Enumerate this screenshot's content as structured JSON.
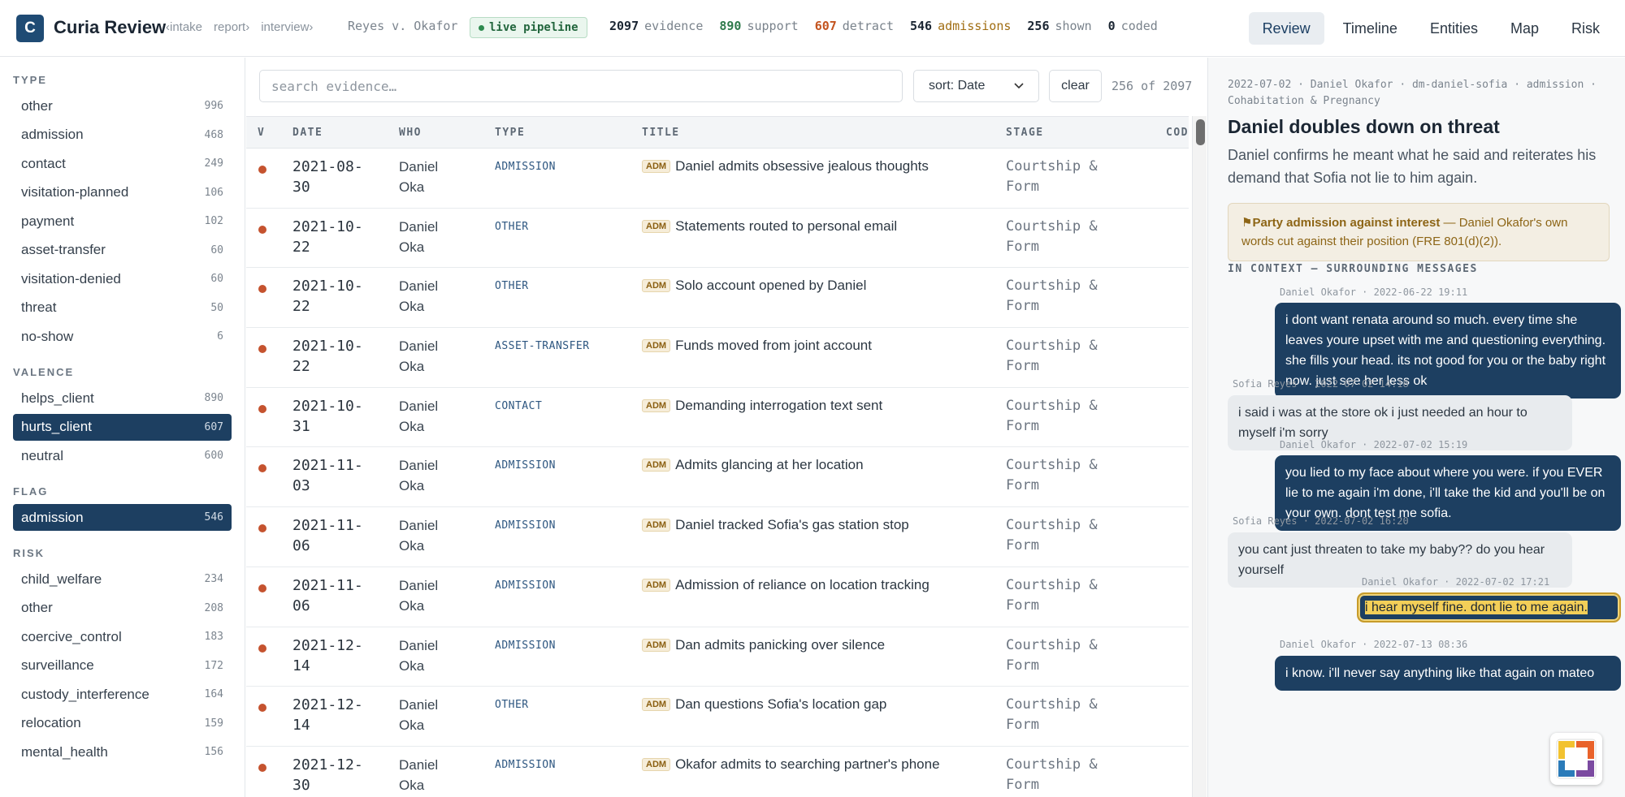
{
  "header": {
    "logo_letter": "C",
    "app_title": "Curia Review",
    "breadcrumbs": [
      "‹intake",
      "report›",
      "interview›"
    ],
    "case_name": "Reyes v. Okafor",
    "pipeline_label": "live pipeline",
    "stats": [
      {
        "value": "2097",
        "label": "evidence",
        "color": "#1b2633"
      },
      {
        "value": "890",
        "label": "support",
        "color": "#2f7a4b"
      },
      {
        "value": "607",
        "label": "detract",
        "color": "#c4541f"
      },
      {
        "value": "546",
        "label": "admissions",
        "color": "#a06d12"
      },
      {
        "value": "256",
        "label": "shown",
        "color": "#1b2633"
      },
      {
        "value": "0",
        "label": "coded",
        "color": "#1b2633"
      }
    ],
    "nav": [
      "Review",
      "Timeline",
      "Entities",
      "Map",
      "Risk"
    ]
  },
  "sidebar": {
    "type_title": "TYPE",
    "types": [
      {
        "label": "other",
        "count": "996"
      },
      {
        "label": "admission",
        "count": "468"
      },
      {
        "label": "contact",
        "count": "249"
      },
      {
        "label": "visitation-planned",
        "count": "106"
      },
      {
        "label": "payment",
        "count": "102"
      },
      {
        "label": "asset-transfer",
        "count": "60"
      },
      {
        "label": "visitation-denied",
        "count": "60"
      },
      {
        "label": "threat",
        "count": "50"
      },
      {
        "label": "no-show",
        "count": "6"
      }
    ],
    "valence_title": "VALENCE",
    "valence": [
      {
        "label": "helps_client",
        "count": "890"
      },
      {
        "label": "hurts_client",
        "count": "607"
      },
      {
        "label": "neutral",
        "count": "600"
      }
    ],
    "flag_title": "FLAG",
    "flags": [
      {
        "label": "admission",
        "count": "546"
      }
    ],
    "risk_title": "RISK",
    "risks": [
      {
        "label": "child_welfare",
        "count": "234"
      },
      {
        "label": "other",
        "count": "208"
      },
      {
        "label": "coercive_control",
        "count": "183"
      },
      {
        "label": "surveillance",
        "count": "172"
      },
      {
        "label": "custody_interference",
        "count": "164"
      },
      {
        "label": "relocation",
        "count": "159"
      },
      {
        "label": "mental_health",
        "count": "156"
      }
    ]
  },
  "main": {
    "search_placeholder": "search evidence…",
    "sort_label": "sort: Date",
    "clear_label": "clear",
    "result_count": "256 of 2097",
    "columns": [
      "V",
      "DATE",
      "WHO",
      "TYPE",
      "TITLE",
      "STAGE",
      "COD"
    ],
    "badge": "ADM",
    "rows": [
      {
        "date": "2021-08-30",
        "who": "Daniel Oka",
        "type": "ADMISSION",
        "title": "Daniel admits obsessive jealous thoughts",
        "stage": "Courtship & Form"
      },
      {
        "date": "2021-10-22",
        "who": "Daniel Oka",
        "type": "OTHER",
        "title": "Statements routed to personal email",
        "stage": "Courtship & Form"
      },
      {
        "date": "2021-10-22",
        "who": "Daniel Oka",
        "type": "OTHER",
        "title": "Solo account opened by Daniel",
        "stage": "Courtship & Form"
      },
      {
        "date": "2021-10-22",
        "who": "Daniel Oka",
        "type": "ASSET-TRANSFER",
        "title": "Funds moved from joint account",
        "stage": "Courtship & Form"
      },
      {
        "date": "2021-10-31",
        "who": "Daniel Oka",
        "type": "CONTACT",
        "title": "Demanding interrogation text sent",
        "stage": "Courtship & Form"
      },
      {
        "date": "2021-11-03",
        "who": "Daniel Oka",
        "type": "ADMISSION",
        "title": "Admits glancing at her location",
        "stage": "Courtship & Form"
      },
      {
        "date": "2021-11-06",
        "who": "Daniel Oka",
        "type": "ADMISSION",
        "title": "Daniel tracked Sofia's gas station stop",
        "stage": "Courtship & Form"
      },
      {
        "date": "2021-11-06",
        "who": "Daniel Oka",
        "type": "ADMISSION",
        "title": "Admission of reliance on location tracking",
        "stage": "Courtship & Form"
      },
      {
        "date": "2021-12-14",
        "who": "Daniel Oka",
        "type": "ADMISSION",
        "title": "Dan admits panicking over silence",
        "stage": "Courtship & Form"
      },
      {
        "date": "2021-12-14",
        "who": "Daniel Oka",
        "type": "OTHER",
        "title": "Dan questions Sofia's location gap",
        "stage": "Courtship & Form"
      },
      {
        "date": "2021-12-30",
        "who": "Daniel Oka",
        "type": "ADMISSION",
        "title": "Okafor admits to searching partner's phone",
        "stage": "Courtship & Form"
      }
    ]
  },
  "detail": {
    "meta": "2022-07-02 · Daniel Okafor · dm-daniel-sofia · admission · Cohabitation & Pregnancy",
    "title": "Daniel doubles down on threat",
    "summary": "Daniel confirms he meant what he said and reiterates his demand that Sofia not lie to him again.",
    "warning_strong": "⚑Party admission against interest",
    "warning_rest": " — Daniel Okafor's own words cut against their position (FRE 801(d)(2)).",
    "context_title": "IN CONTEXT — SURROUNDING MESSAGES",
    "messages": [
      {
        "meta": "Daniel Okafor · 2022-06-22 19:11",
        "text": "i dont want renata around so much. every time she leaves youre upset with me and questioning everything. she fills your head. its not good for you or the baby right now. just see her less ok"
      },
      {
        "meta": "Sofia Reyes · 2022-07-02 14:18",
        "text": "i said i was at the store ok i just needed an hour to myself i'm sorry"
      },
      {
        "meta": "Daniel Okafor · 2022-07-02 15:19",
        "text": "you lied to my face about where you were. if you EVER lie to me again i'm done, i'll take the kid and you'll be on your own. dont test me sofia."
      },
      {
        "meta": "Sofia Reyes · 2022-07-02 16:20",
        "text": "you cant just threaten to take my baby?? do you hear yourself"
      },
      {
        "meta": "Daniel Okafor · 2022-07-02 17:21",
        "text": "i hear myself fine. dont lie to me again."
      },
      {
        "meta": "Daniel Okafor · 2022-07-13 08:36",
        "text": "i know. i'll never say anything like that again on mateo"
      }
    ]
  }
}
